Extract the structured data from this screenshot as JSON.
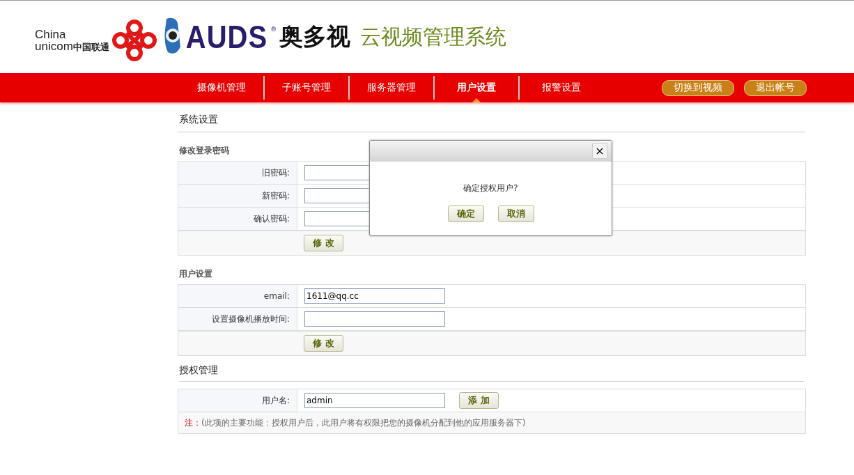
{
  "header": {
    "unicom_logo": {
      "line_1": "China",
      "line_2": "unicom",
      "line_3": "中国联通"
    },
    "auds_logo": {
      "brand": "AUDS",
      "mark": "®",
      "chinese_name": "奥多视"
    },
    "system_title": "云视频管理系统"
  },
  "nav": {
    "items": [
      {
        "label": "摄像机管理",
        "selected": false
      },
      {
        "label": "子账号管理",
        "selected": false
      },
      {
        "label": "服务器管理",
        "selected": false
      },
      {
        "label": "用户设置",
        "selected": true
      },
      {
        "label": "报警设置",
        "selected": false
      }
    ],
    "actions": [
      "切换到视频",
      "退出帐号"
    ]
  },
  "page_title": "系统设置",
  "sections": [
    {
      "title": "修改登录密码",
      "kind": "sub",
      "rows": [
        {
          "label": "旧密码:",
          "value": ""
        },
        {
          "label": "新密码:",
          "value": ""
        },
        {
          "label": "确认密码:",
          "value": ""
        }
      ],
      "submit": "修 改"
    },
    {
      "title": "用户设置",
      "kind": "sub",
      "rows": [
        {
          "label": "email:",
          "value": "1611@qq.cc"
        },
        {
          "label": "设置摄像机播放时间:",
          "value": ""
        }
      ],
      "submit": "修 改"
    },
    {
      "title": "授权管理",
      "kind": "main",
      "rows": [
        {
          "label": "用户名:",
          "value": "admin",
          "button": "添 加"
        }
      ],
      "note": {
        "label": "注：",
        "text": "(此项的主要功能：授权用户后，此用户将有权限把您的摄像机分配到他的应用服务器下)"
      }
    }
  ],
  "dialog": {
    "close": "×",
    "message": "确定授权用户?",
    "buttons": [
      "确定",
      "取消"
    ]
  }
}
